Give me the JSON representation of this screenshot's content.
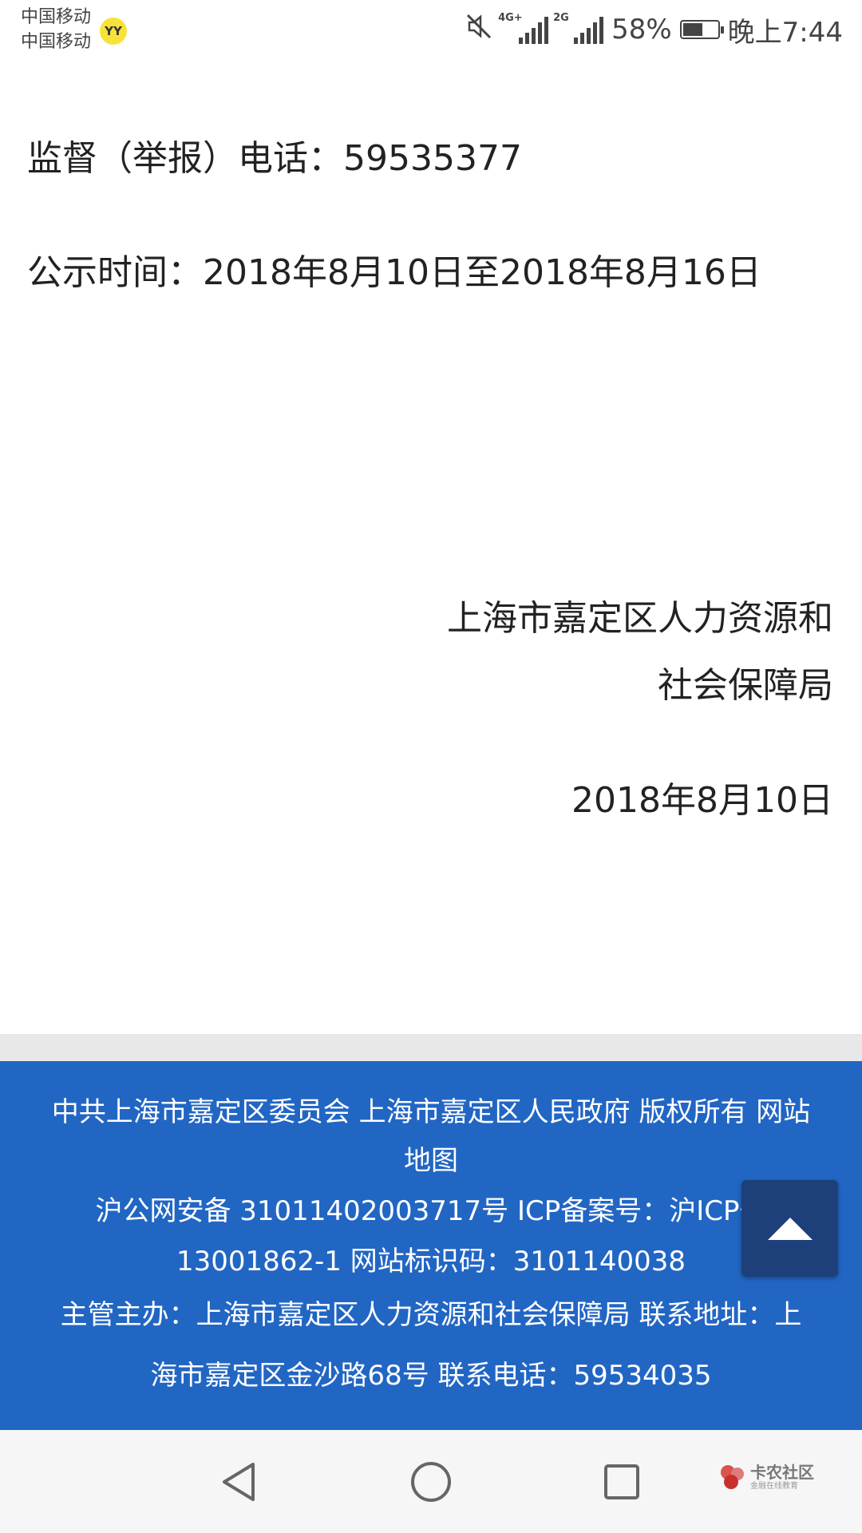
{
  "status_bar": {
    "carrier_1": "中国移动",
    "carrier_2": "中国移动",
    "app_badge": "YY",
    "network_1": "4G+",
    "network_2": "2G",
    "battery": "58%",
    "battery_level": 0.58,
    "time": "晚上7:44"
  },
  "article": {
    "supervision_line": "监督（举报）电话：59535377",
    "publicity_line": "公示时间：2018年8月10日至2018年8月16日",
    "issuer_line_1": "上海市嘉定区人力资源和",
    "issuer_line_2": "社会保障局",
    "issue_date": "2018年8月10日"
  },
  "footer": {
    "line_1": "中共上海市嘉定区委员会 上海市嘉定区人民政府 版权所有  网站",
    "line_2": "地图",
    "line_3": "沪公网安备 31011402003717号  ICP备案号：沪ICP备",
    "line_4": "13001862-1  网站标识码：3101140038",
    "line_5": "主管主办：上海市嘉定区人力资源和社会保障局  联系地址：上",
    "line_6": "海市嘉定区金沙路68号  联系电话：59534035"
  },
  "watermark": {
    "name": "卡农社区",
    "tagline": "金融在线教育"
  },
  "colors": {
    "footer_bg": "#2266c4",
    "back_to_top_bg": "#1d3f7a",
    "divider": "#e8e8e8",
    "navbar_bg": "#f6f6f6"
  }
}
